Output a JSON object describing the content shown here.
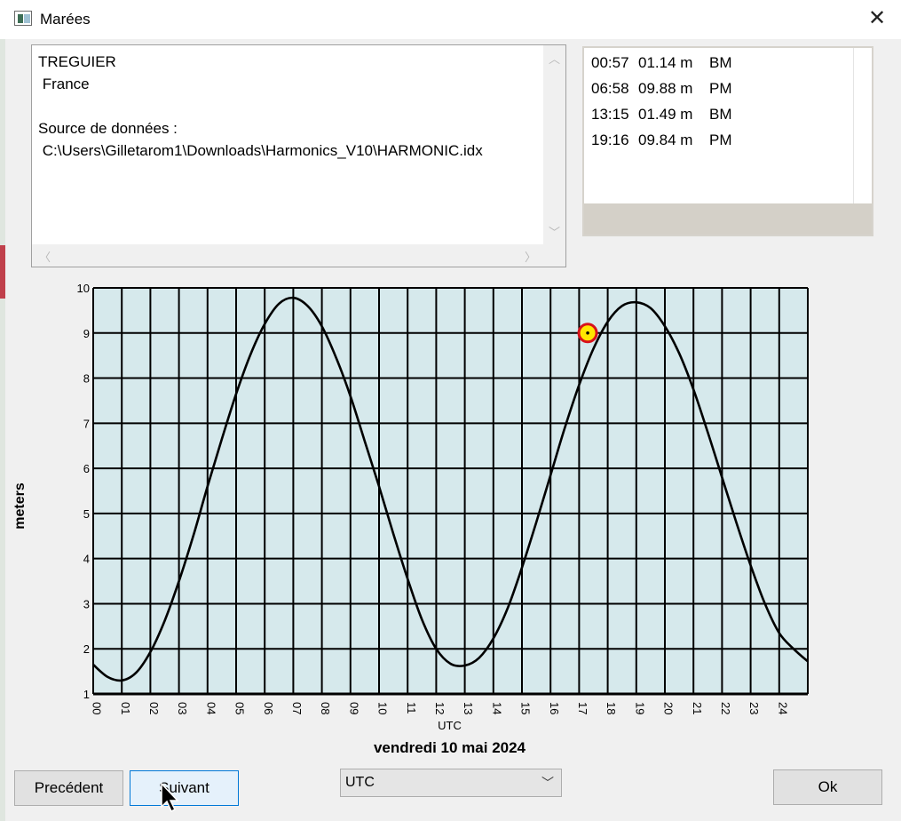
{
  "window": {
    "title": "Marées",
    "close_glyph": "✕",
    "icon": "app-icon"
  },
  "info": {
    "lines": [
      "TREGUIER",
      " France",
      "",
      "Source de données :",
      " C:\\Users\\Gilletarom1\\Downloads\\Harmonics_V10\\HARMONIC.idx"
    ]
  },
  "tides": [
    {
      "time": "00:57",
      "height": "01.14 m",
      "type": "BM"
    },
    {
      "time": "06:58",
      "height": "09.88 m",
      "type": "PM"
    },
    {
      "time": "13:15",
      "height": "01.49 m",
      "type": "BM"
    },
    {
      "time": "19:16",
      "height": "09.84 m",
      "type": "PM"
    }
  ],
  "chart_data": {
    "type": "line",
    "ylabel": "meters",
    "xlabel": "UTC",
    "ylim": [
      1,
      10
    ],
    "xlim": [
      0,
      25
    ],
    "x_ticks": [
      "00",
      "01",
      "02",
      "03",
      "04",
      "05",
      "06",
      "07",
      "08",
      "09",
      "10",
      "11",
      "12",
      "13",
      "14",
      "15",
      "16",
      "17",
      "18",
      "19",
      "20",
      "21",
      "22",
      "23",
      "24"
    ],
    "y_ticks": [
      "1",
      "2",
      "3",
      "4",
      "5",
      "6",
      "7",
      "8",
      "9",
      "10"
    ],
    "background": "#d6e9ec",
    "grid": true,
    "series": [
      {
        "x": [
          0,
          0.5,
          1,
          1.5,
          2,
          2.5,
          3,
          3.5,
          4,
          4.5,
          5,
          5.5,
          6,
          6.5,
          7,
          7.5,
          8,
          8.5,
          9,
          9.5,
          10,
          10.5,
          11,
          11.5,
          12,
          12.5,
          13,
          13.5,
          14,
          14.5,
          15,
          15.5,
          16,
          16.5,
          17,
          17.5,
          18,
          18.5,
          19,
          19.5,
          20,
          20.5,
          21,
          21.5,
          22,
          22.5,
          23,
          23.5,
          24,
          24.5,
          25
        ],
        "y": [
          1.65,
          1.38,
          1.3,
          1.47,
          1.93,
          2.62,
          3.5,
          4.5,
          5.6,
          6.65,
          7.65,
          8.52,
          9.2,
          9.65,
          9.78,
          9.6,
          9.15,
          8.45,
          7.6,
          6.6,
          5.6,
          4.55,
          3.55,
          2.65,
          2.0,
          1.67,
          1.63,
          1.8,
          2.23,
          2.9,
          3.8,
          4.8,
          5.85,
          6.9,
          7.85,
          8.65,
          9.25,
          9.6,
          9.68,
          9.55,
          9.15,
          8.55,
          7.75,
          6.8,
          5.8,
          4.8,
          3.85,
          3.0,
          2.35,
          2.0,
          1.72
        ]
      }
    ],
    "current_marker": {
      "x": 17.3,
      "y": 9.0
    }
  },
  "date_label": "vendredi 10 mai 2024",
  "buttons": {
    "prev": "Precédent",
    "next": "Suivant",
    "ok": "Ok"
  },
  "timezone_select": {
    "value": "UTC"
  }
}
